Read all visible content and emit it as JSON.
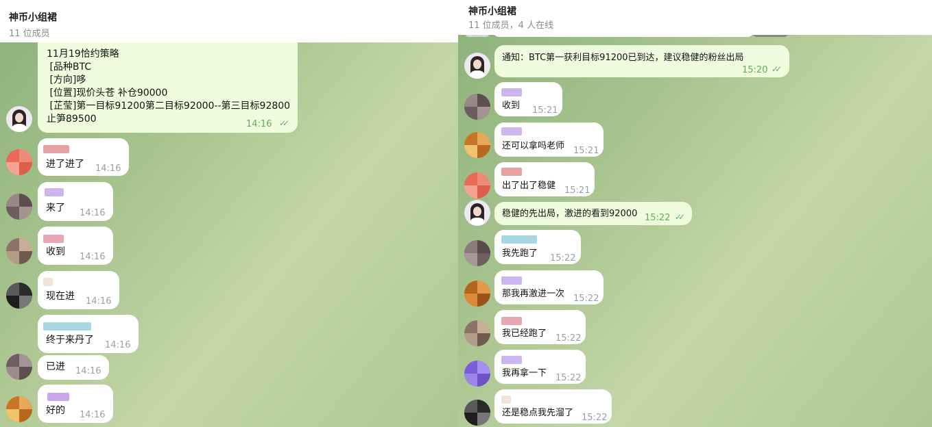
{
  "left_chat": {
    "header": {
      "title": "神币小组裙",
      "subtitle": "11 位成员"
    },
    "messages": [
      {
        "text": "11月19恰约策略\n [品种BTC\n [方向]哆\n [位置]现价头苍 补仓90000\n [芷莹]第一目标91200第二目标92000--第三目标92800\n止笋89500",
        "time": "14:16",
        "outgoing": true
      },
      {
        "text": "进了进了",
        "time": "14:16"
      },
      {
        "text": "来了",
        "time": "14:16"
      },
      {
        "text": "收到",
        "time": "14:16"
      },
      {
        "text": "现在进",
        "time": "14:16"
      },
      {
        "text": "终于来丹了",
        "time": "14:16"
      },
      {
        "text": "已进",
        "time": "14:16"
      },
      {
        "text": "好的",
        "time": "14:16"
      }
    ]
  },
  "right_chat": {
    "header": {
      "title": "神币小组裙",
      "subtitle": "11 位成员，4 人在线"
    },
    "messages": [
      {
        "text": "通知：BTC第一获利目标91200已到达，建议稳健的粉丝出局",
        "time": "15:20",
        "outgoing": true
      },
      {
        "text": "收到",
        "time": "15:21"
      },
      {
        "text": "还可以拿吗老师",
        "time": "15:21"
      },
      {
        "text": "出了出了稳健",
        "time": "15:21"
      },
      {
        "text": "稳健的先出局，激进的看到92000",
        "time": "15:22",
        "outgoing": true
      },
      {
        "text": "我先跑了",
        "time": "15:22"
      },
      {
        "text": "那我再激进一次",
        "time": "15:22"
      },
      {
        "text": "我已经跑了",
        "time": "15:22"
      },
      {
        "text": "我再拿一下",
        "time": "15:22"
      },
      {
        "text": "还是稳点我先溜了",
        "time": "15:22"
      }
    ]
  },
  "colors": {
    "outgoing_bubble": "#effdde",
    "incoming_bubble": "#ffffff",
    "read_check": "#5fad56",
    "timestamp": "#9aa0a6"
  },
  "icons": {
    "read_receipt": "double-check-icon"
  }
}
